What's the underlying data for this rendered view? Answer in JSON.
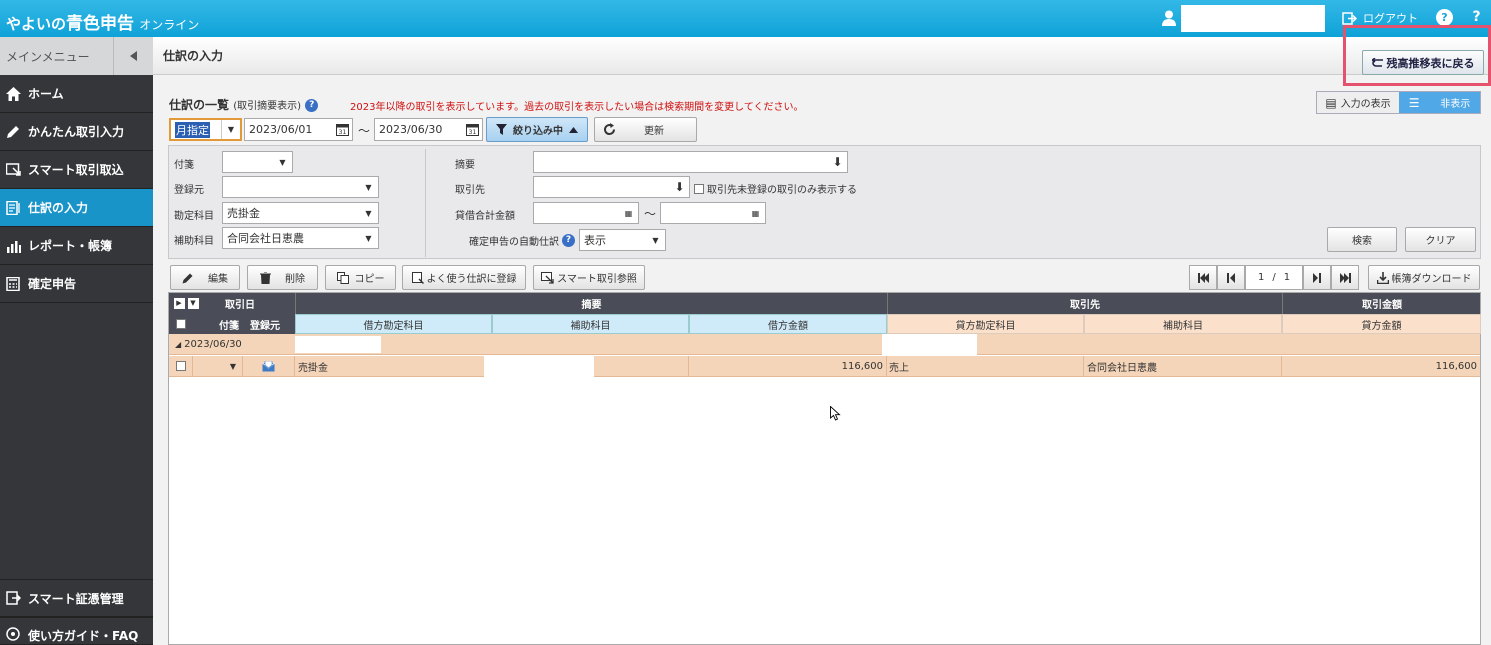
{
  "app": {
    "logo_main": "やよいの",
    "logo_brand": "青色申告",
    "logo_sub": "オンライン",
    "logout": "ログアウト",
    "help": "?"
  },
  "sidebar": {
    "menu_title": "メインメニュー",
    "items": [
      {
        "label": "ホーム",
        "icon": "home-icon"
      },
      {
        "label": "かんたん取引入力",
        "icon": "pencil-icon"
      },
      {
        "label": "スマート取引取込",
        "icon": "import-icon"
      },
      {
        "label": "仕訳の入力",
        "icon": "journal-icon",
        "active": true
      },
      {
        "label": "レポート・帳簿",
        "icon": "chart-icon"
      },
      {
        "label": "確定申告",
        "icon": "calculator-icon"
      }
    ],
    "bottom": [
      {
        "label": "スマート証憑管理",
        "icon": "document-icon"
      },
      {
        "label": "使い方ガイド・FAQ",
        "icon": "guide-icon"
      }
    ]
  },
  "page": {
    "title": "仕訳の入力",
    "back_button": "残高推移表に戻る",
    "list_title": "仕訳の一覧",
    "list_subtitle": "(取引摘要表示)",
    "notice": "2023年以降の取引を表示しています。過去の取引を表示したい場合は検索期間を変更してください。",
    "view_show": "入力の表示",
    "view_hide": "非表示"
  },
  "toolbar": {
    "period_mode": "月指定",
    "date_from": "2023/06/01",
    "date_sep": "～",
    "date_to": "2023/06/30",
    "filter_label": "絞り込み中",
    "refresh_label": "更新"
  },
  "filters": {
    "fusen_label": "付箋",
    "source_label": "登録元",
    "account_label": "勘定科目",
    "account_value": "売掛金",
    "sub_label": "補助科目",
    "sub_value": "合同会社日恵農",
    "memo_label": "摘要",
    "partner_label": "取引先",
    "partner_unregistered": "取引先未登録の取引のみ表示する",
    "amount_label": "貸借合計金額",
    "amount_sep": "～",
    "auto_label": "確定申告の自動仕訳",
    "auto_value": "表示",
    "search_button": "検索",
    "clear_button": "クリア"
  },
  "actions": {
    "edit": "編集",
    "delete": "削除",
    "copy": "コピー",
    "register_frequent": "よく使う仕訳に登録",
    "smart_ref": "スマート取引参照",
    "page_current": "1",
    "page_sep": "/",
    "page_total": "1",
    "download": "帳簿ダウンロード"
  },
  "grid": {
    "h_date": "取引日",
    "h_memo": "摘要",
    "h_partner": "取引先",
    "h_amount": "取引金額",
    "h_fusen": "付箋",
    "h_source": "登録元",
    "h_debit_account": "借方勘定科目",
    "h_debit_sub": "補助科目",
    "h_debit_amount": "借方金額",
    "h_credit_account": "貸方勘定科目",
    "h_credit_sub": "補助科目",
    "h_credit_amount": "貸方金額",
    "group_date": "2023/06/30",
    "row": {
      "debit_account": "売掛金",
      "debit_amount": "116,600",
      "credit_account": "売上",
      "credit_sub": "合同会社日恵農",
      "credit_amount": "116,600"
    }
  },
  "colors": {
    "header": "#1aa7dc",
    "sidebar": "#35363a",
    "active": "#1894c9",
    "debit_header": "#cfeaf8",
    "credit_header": "#fbe1cc",
    "row": "#f5d5b9",
    "highlight": "#e4526e"
  }
}
